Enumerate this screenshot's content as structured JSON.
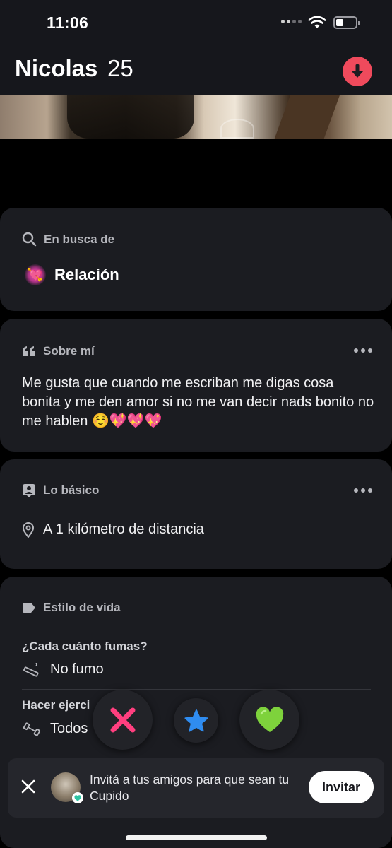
{
  "status_bar": {
    "time": "11:06"
  },
  "profile": {
    "name": "Nicolas",
    "age": "25"
  },
  "looking_for": {
    "heading": "En busca de",
    "emoji": "💘",
    "value": "Relación"
  },
  "about": {
    "heading": "Sobre mí",
    "bio": "Me gusta que cuando me escriban me digas cosa bonita y me den amor si no me van decir nads bonito no me hablen ☺️💖💖💖"
  },
  "basics": {
    "heading": "Lo básico",
    "distance": "A 1 kilómetro de distancia"
  },
  "lifestyle": {
    "heading": "Estilo de vida",
    "items": [
      {
        "question": "¿Cada cuánto fumas?",
        "answer": "No fumo"
      },
      {
        "question": "Hacer ejerci",
        "answer": "Todos"
      }
    ]
  },
  "actions": {
    "nope_icon": "x-icon",
    "super_like_icon": "star-icon",
    "like_icon": "heart-icon"
  },
  "invite": {
    "text": "Invitá a tus amigos para que sean tu Cupido",
    "button": "Invitar"
  },
  "colors": {
    "accent_red": "#ef4a5c",
    "nope_pink": "#ff3f7f",
    "super_blue": "#2f8cf0",
    "like_green": "#7ed23c"
  }
}
